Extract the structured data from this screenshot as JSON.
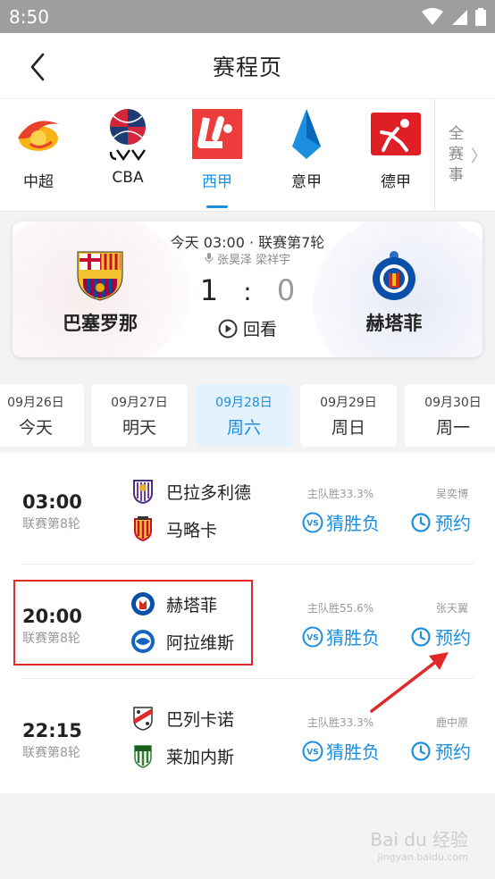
{
  "status": {
    "time": "8:50"
  },
  "nav": {
    "title": "赛程页"
  },
  "leagues": [
    {
      "name": "中超",
      "icon": "csl-logo-icon"
    },
    {
      "name": "CBA",
      "icon": "cba-logo-icon"
    },
    {
      "name": "西甲",
      "icon": "laliga-logo-icon",
      "active": true
    },
    {
      "name": "意甲",
      "icon": "serie-a-logo-icon"
    },
    {
      "name": "德甲",
      "icon": "bundesliga-logo-icon"
    }
  ],
  "all_events": {
    "label": "全赛事",
    "chevron": "〉"
  },
  "feature": {
    "meta": "今天 03:00 · 联赛第7轮",
    "commentators": "张昊泽 梁祥宇",
    "home": {
      "name": "巴塞罗那"
    },
    "away": {
      "name": "赫塔菲"
    },
    "home_score": "1",
    "score_sep": ":",
    "away_score": "0",
    "replay_label": "回看"
  },
  "dates": [
    {
      "date": "09月26日",
      "weekday": "今天"
    },
    {
      "date": "09月27日",
      "weekday": "明天"
    },
    {
      "date": "09月28日",
      "weekday": "周六",
      "active": true
    },
    {
      "date": "09月29日",
      "weekday": "周日"
    },
    {
      "date": "09月30日",
      "weekday": "周一"
    }
  ],
  "matches": [
    {
      "time": "03:00",
      "round": "联赛第8轮",
      "home": "巴拉多利德",
      "away": "马略卡",
      "home_pct": "主队胜33.3%",
      "anchor": "吴奕博",
      "guess": "猜胜负",
      "book": "预约"
    },
    {
      "time": "20:00",
      "round": "联赛第8轮",
      "home": "赫塔菲",
      "away": "阿拉维斯",
      "home_pct": "主队胜55.6%",
      "anchor": "张天翼",
      "guess": "猜胜负",
      "book": "预约"
    },
    {
      "time": "22:15",
      "round": "联赛第8轮",
      "home": "巴列卡诺",
      "away": "莱加内斯",
      "home_pct": "主队胜33.3%",
      "anchor": "鹿中原",
      "guess": "猜胜负",
      "book": "预约"
    }
  ],
  "colors": {
    "accent": "#1a8fe0",
    "highlight": "#e02a2a"
  },
  "watermark": {
    "brand": "Bai du 经验",
    "url": "jingyan.baidu.com"
  }
}
